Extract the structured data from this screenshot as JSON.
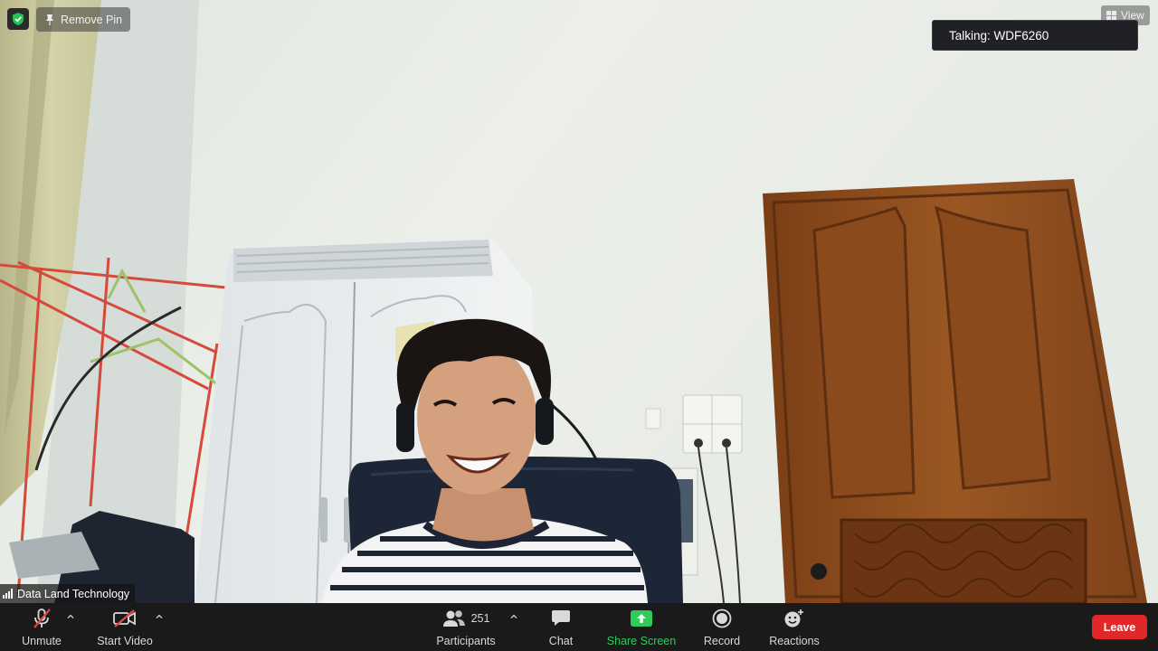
{
  "overlay": {
    "remove_pin_label": "Remove Pin",
    "view_label": "View",
    "talking_text": "Talking: WDF6260",
    "shield_icon": "shield-check-icon",
    "shield_color": "#23c552"
  },
  "video": {
    "participant_name": "Data Land Technology"
  },
  "toolbar": {
    "unmute_label": "Unmute",
    "start_video_label": "Start Video",
    "participants_label": "Participants",
    "participants_count": "251",
    "chat_label": "Chat",
    "share_screen_label": "Share Screen",
    "record_label": "Record",
    "reactions_label": "Reactions",
    "leave_label": "Leave",
    "share_color": "#2ecc5b",
    "leave_color": "#e02828",
    "muted_color": "#e04848"
  }
}
